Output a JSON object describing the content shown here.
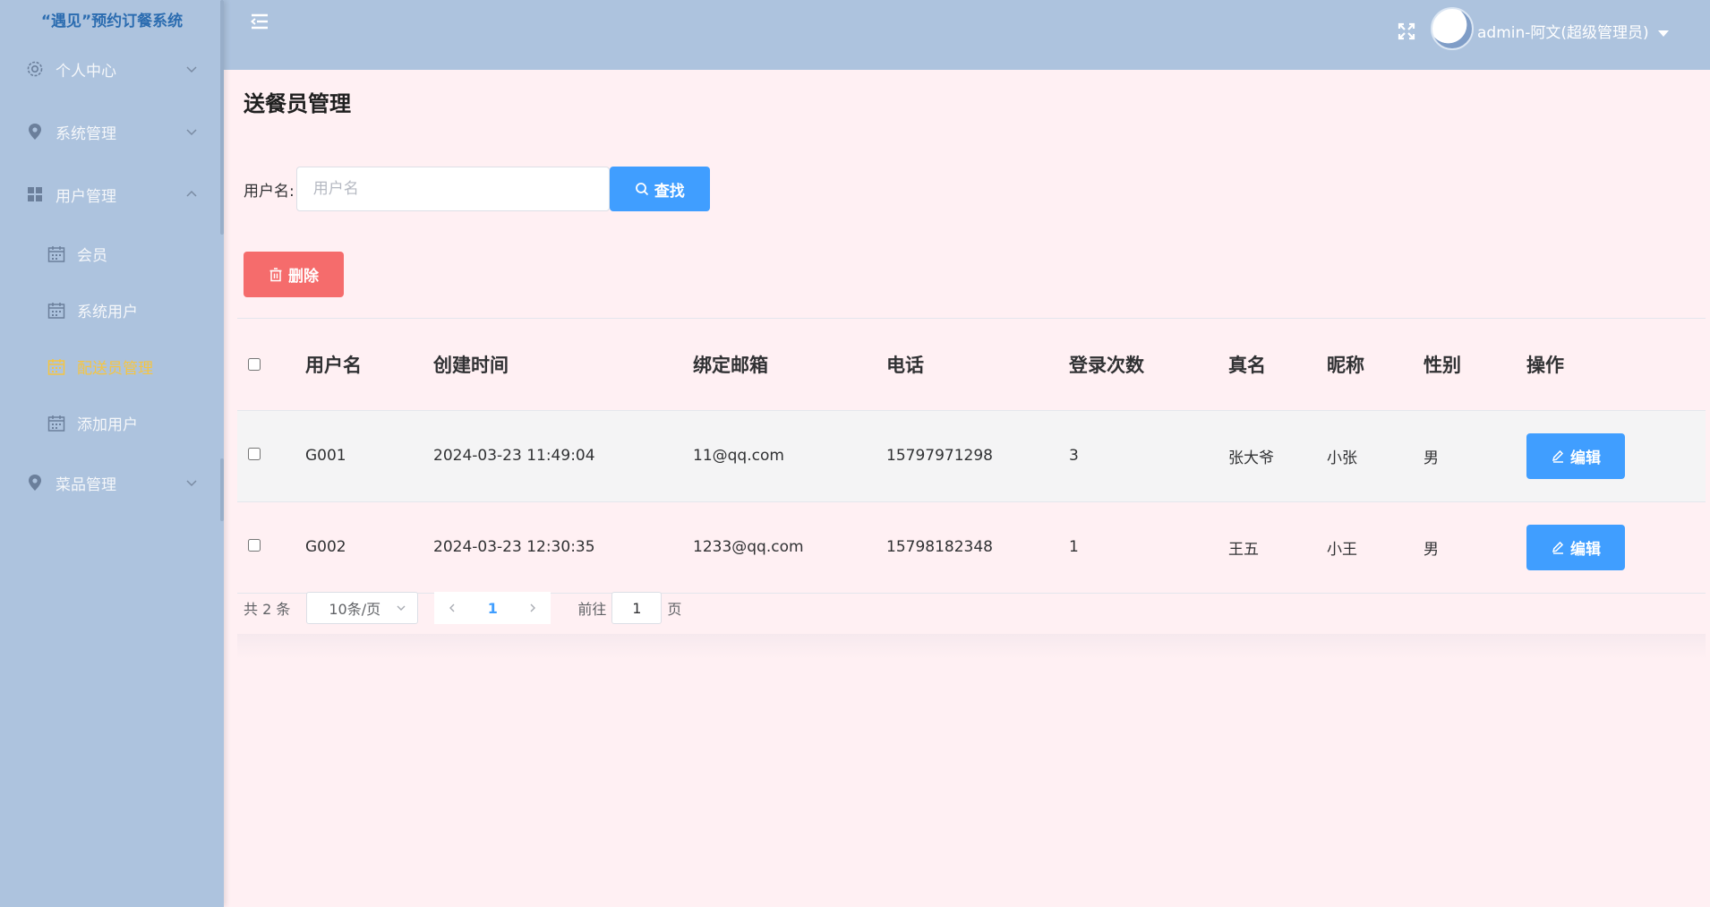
{
  "app": {
    "title": "“遇见”预约订餐系统"
  },
  "sidebar": {
    "items": [
      {
        "label": "个人中心",
        "icon": "gear-icon"
      },
      {
        "label": "系统管理",
        "icon": "location-pin-icon"
      },
      {
        "label": "用户管理",
        "icon": "grid-icon",
        "children": [
          {
            "label": "会员",
            "icon": "calendar-icon"
          },
          {
            "label": "系统用户",
            "icon": "calendar-icon"
          },
          {
            "label": "配送员管理",
            "icon": "calendar-icon",
            "active": true
          },
          {
            "label": "添加用户",
            "icon": "calendar-icon"
          }
        ]
      },
      {
        "label": "菜品管理",
        "icon": "location-pin-icon"
      }
    ],
    "active_color": "#f5c542"
  },
  "header": {
    "user": "admin-阿文(超级管理员)"
  },
  "main": {
    "title": "送餐员管理",
    "search": {
      "label": "用户名:",
      "placeholder": "用户名",
      "value": "",
      "button": "查找"
    },
    "delete_button": "删除",
    "table": {
      "columns": [
        "用户名",
        "创建时间",
        "绑定邮箱",
        "电话",
        "登录次数",
        "真名",
        "昵称",
        "性别",
        "操作"
      ],
      "rows": [
        {
          "username": "G001",
          "created": "2024-03-23 11:49:04",
          "email": "11@qq.com",
          "phone": "15797971298",
          "logins": "3",
          "realname": "张大爷",
          "nickname": "小张",
          "gender": "男",
          "action": "编辑"
        },
        {
          "username": "G002",
          "created": "2024-03-23 12:30:35",
          "email": "1233@qq.com",
          "phone": "15798182348",
          "logins": "1",
          "realname": "王五",
          "nickname": "小王",
          "gender": "男",
          "action": "编辑"
        }
      ]
    },
    "pagination": {
      "total": "共 2 条",
      "page_size": "10条/页",
      "current": "1",
      "goto_label": "前往",
      "goto_value": "1",
      "goto_suffix": "页"
    }
  },
  "colors": {
    "primary": "#409eff",
    "danger": "#f56c6c",
    "sidebar": "#adc3de",
    "background": "#fff0f3"
  }
}
